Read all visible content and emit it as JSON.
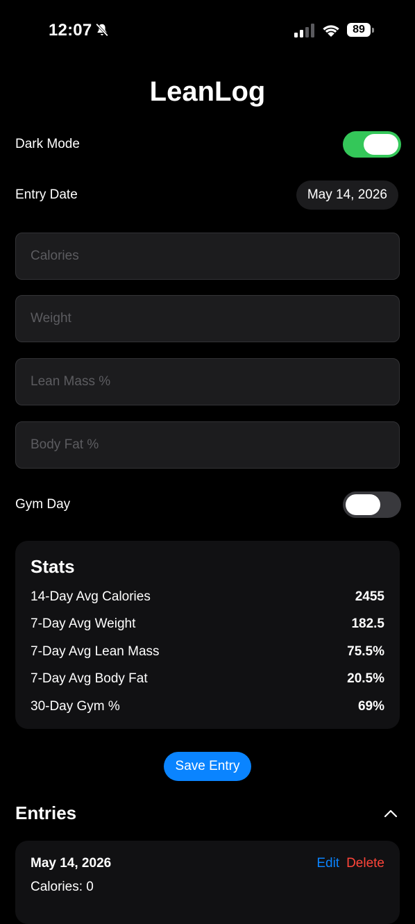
{
  "status_bar": {
    "time": "12:07",
    "battery": "89",
    "icons": [
      "bell-slash-icon",
      "signal-icon",
      "wifi-icon",
      "battery-icon"
    ]
  },
  "app": {
    "title": "LeanLog"
  },
  "settings": {
    "dark_mode_label": "Dark Mode",
    "dark_mode_on": true,
    "entry_date_label": "Entry Date",
    "entry_date_value": "May 14, 2026"
  },
  "form": {
    "calories_placeholder": "Calories",
    "weight_placeholder": "Weight",
    "lean_mass_placeholder": "Lean Mass %",
    "body_fat_placeholder": "Body Fat %",
    "gym_day_label": "Gym Day",
    "gym_day_on": false
  },
  "stats": {
    "title": "Stats",
    "rows": [
      {
        "label": "14-Day Avg Calories",
        "value": "2455"
      },
      {
        "label": "7-Day Avg Weight",
        "value": "182.5"
      },
      {
        "label": "7-Day Avg Lean Mass",
        "value": "75.5%"
      },
      {
        "label": "7-Day Avg Body Fat",
        "value": "20.5%"
      },
      {
        "label": "30-Day Gym %",
        "value": "69%"
      }
    ]
  },
  "actions": {
    "save_label": "Save Entry"
  },
  "entries": {
    "title": "Entries",
    "items": [
      {
        "date": "May 14, 2026",
        "edit_label": "Edit",
        "delete_label": "Delete",
        "calories_text": "Calories: 0"
      }
    ]
  },
  "colors": {
    "background": "#000000",
    "toggle_on": "#34c759",
    "accent_blue": "#0a84ff",
    "destructive_red": "#ff453a",
    "card": "#111113",
    "field": "#1c1c1e"
  }
}
